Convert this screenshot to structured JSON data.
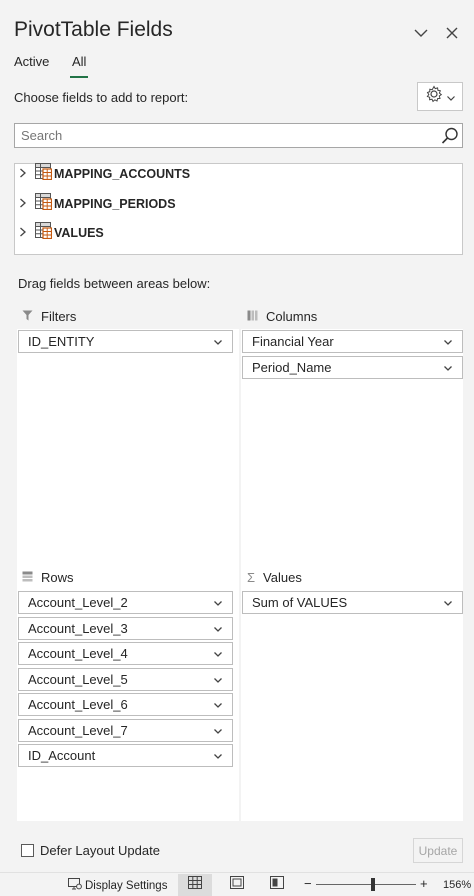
{
  "header": {
    "title": "PivotTable Fields"
  },
  "tabs": [
    {
      "label": "Active"
    },
    {
      "label": "All"
    }
  ],
  "choose_label": "Choose fields to add to report:",
  "search": {
    "placeholder": "Search",
    "value": ""
  },
  "fields": [
    {
      "name": "MAPPING_ACCOUNTS"
    },
    {
      "name": "MAPPING_PERIODS"
    },
    {
      "name": "VALUES"
    }
  ],
  "drag_label": "Drag fields between areas below:",
  "areas": {
    "filters": {
      "title": "Filters",
      "items": [
        "ID_ENTITY"
      ]
    },
    "columns": {
      "title": "Columns",
      "items": [
        "Financial Year",
        "Period_Name"
      ]
    },
    "rows": {
      "title": "Rows",
      "items": [
        "Account_Level_2",
        "Account_Level_3",
        "Account_Level_4",
        "Account_Level_5",
        "Account_Level_6",
        "Account_Level_7",
        "ID_Account"
      ]
    },
    "values": {
      "title": "Values",
      "items": [
        "Sum of VALUES"
      ]
    }
  },
  "defer": {
    "label": "Defer Layout Update",
    "checked": false
  },
  "update_label": "Update",
  "statusbar": {
    "display_settings": "Display Settings",
    "zoom": "156%"
  },
  "colors": {
    "accent": "#217346",
    "panel": "#f3f3f3"
  }
}
